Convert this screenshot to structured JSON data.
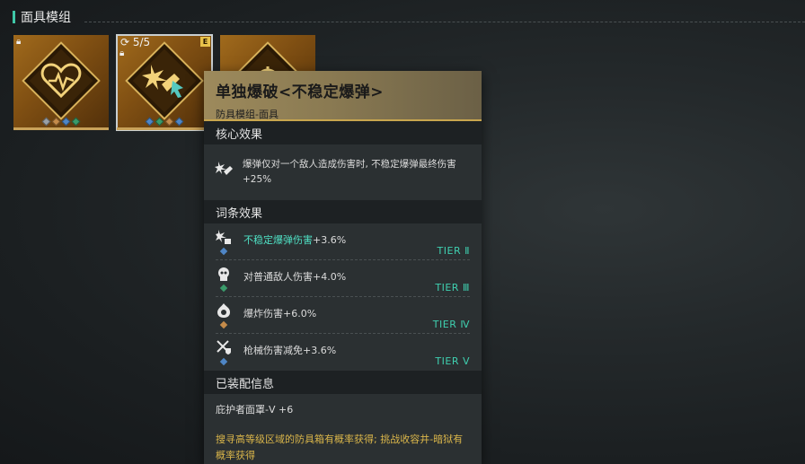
{
  "section": {
    "title": "面具模组"
  },
  "cards": [
    {
      "gems": [
        "#9aa0a6",
        "#c58b4a",
        "#4f86c6",
        "#3a9a6a"
      ]
    },
    {
      "level": "5/5",
      "badge": "E",
      "gems": [
        "#4f86c6",
        "#3a9a6a",
        "#c58b4a",
        "#4f86c6"
      ]
    },
    {}
  ],
  "tooltip": {
    "name": "单独爆破<不稳定爆弹>",
    "subtitle": "防具模组-面具",
    "core_header": "核心效果",
    "core_text": "爆弹仅对一个敌人造成伤害时, 不稳定爆弹最终伤害+25%",
    "affix_header": "词条效果",
    "affixes": [
      {
        "label": "不稳定爆弹伤害",
        "value": "+3.6%",
        "tier": "TIER Ⅱ",
        "tier_color": "#3fd0b0",
        "gem": "#4f86c6"
      },
      {
        "label": "对普通敌人伤害",
        "value": "+4.0%",
        "tier": "TIER Ⅲ",
        "tier_color": "#3fd0b0",
        "gem": "#3a9a6a"
      },
      {
        "label": "爆炸伤害",
        "value": "+6.0%",
        "tier": "TIER Ⅳ",
        "tier_color": "#3fd0b0",
        "gem": "#c58b4a"
      },
      {
        "label": "枪械伤害减免",
        "value": "+3.6%",
        "tier": "TIER Ⅴ",
        "tier_color": "#3fd0b0",
        "gem": "#4f86c6"
      }
    ],
    "equipped_header": "已装配信息",
    "equipped_on": "庇护者面罩-Ⅴ +6",
    "source": "搜寻高等级区域的防具箱有概率获得; 挑战收容井-暗狱有概率获得"
  }
}
